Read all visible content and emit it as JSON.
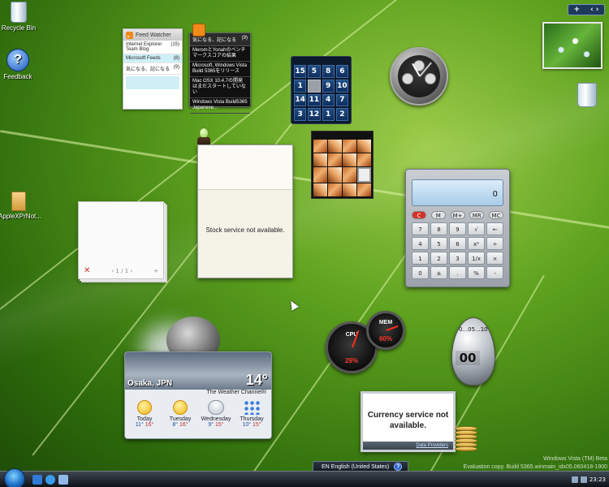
{
  "desktop_icons": [
    {
      "label": "Recycle Bin",
      "icon": "recycle-bin-icon"
    },
    {
      "label": "Feedback",
      "icon": "feedback-icon"
    },
    {
      "label": "AppleXPrNot...",
      "icon": "folder-icon"
    }
  ],
  "sidebar_controls": {
    "add": "+",
    "nav": "‹ ›"
  },
  "feed_watcher": {
    "title": "Feed Watcher",
    "items": [
      {
        "name": "Internet Explorer Team Blog",
        "count": "(15)"
      },
      {
        "name": "Microsoft Feeds",
        "count": "(8)",
        "selected": true
      },
      {
        "name": "気になる、記になる",
        "count": "(9)"
      }
    ]
  },
  "headlines": {
    "title": "気になる、記になる",
    "count": "(9)",
    "items": [
      "MeromとYonahのベンチマークスコアの結果",
      "Microsoft, Windows Vista Build 5365をリリース",
      "Mac OSX 10.4.7の開発はまだスタートしていない",
      "Windows Vista Build5365 Japanese..."
    ]
  },
  "number_puzzle": {
    "tiles": [
      "15",
      "5",
      "8",
      "6",
      "1",
      "",
      "9",
      "10",
      "14",
      "11",
      "4",
      "7",
      "3",
      "12",
      "1",
      "2"
    ]
  },
  "stock": {
    "message": "Stock service not available."
  },
  "notes": {
    "page": "1 / 1",
    "delete": "✕",
    "prev": "‹",
    "next": "›",
    "add": "+"
  },
  "calculator": {
    "display": "0",
    "memory_keys": [
      "C",
      "M",
      "M+",
      "MR",
      "MC"
    ],
    "keys": [
      "7",
      "8",
      "9",
      "√",
      "←",
      "4",
      "5",
      "6",
      "x²",
      "÷",
      "1",
      "2",
      "3",
      "1/x",
      "×",
      "0",
      "±",
      ".",
      "%",
      "-"
    ],
    "equals": "=",
    "plus": "+"
  },
  "weather": {
    "city": "Osaka, JPN",
    "temp": "14°",
    "provider": "The Weather Channel®",
    "days": [
      {
        "name": "Today",
        "hi": "11°",
        "lo": "16°",
        "icon": "sun"
      },
      {
        "name": "Tuesday",
        "hi": "8°",
        "lo": "16°",
        "icon": "sun"
      },
      {
        "name": "Wednesday",
        "hi": "9°",
        "lo": "15°",
        "icon": "storm"
      },
      {
        "name": "Thursday",
        "hi": "10°",
        "lo": "15°",
        "icon": "rain"
      }
    ]
  },
  "cpu_meter": {
    "cpu_label": "CPU",
    "cpu_value": "29%",
    "mem_label": "MEM",
    "mem_value": "60%"
  },
  "egg_timer": {
    "display": "00",
    "scale": "0...05...10"
  },
  "currency": {
    "message": "Currency service not available.",
    "link": "Data Providers"
  },
  "watermark": {
    "line1": "Windows Vista (TM) Beta",
    "line2": "Evaluation copy. Build 5365.winmain_idx05.060418-1900"
  },
  "taskbar": {
    "language": "EN English (United States)",
    "help": "?",
    "clock": "23:23"
  },
  "colors": {
    "accent": "#1f6fc6",
    "leaf": "#5ea21f"
  }
}
